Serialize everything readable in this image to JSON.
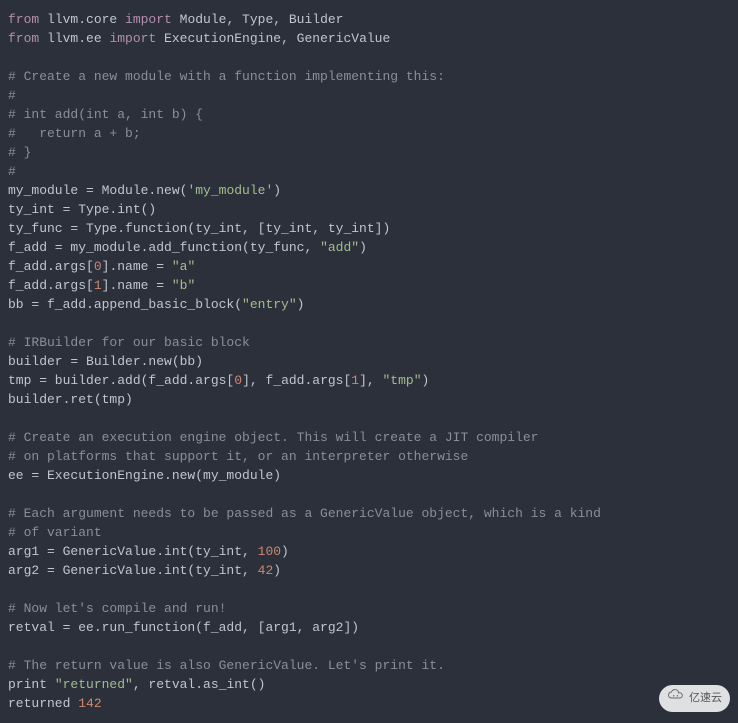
{
  "code": {
    "tokens": [
      [
        {
          "t": "from ",
          "c": "kw"
        },
        {
          "t": "llvm.core ",
          "c": "id"
        },
        {
          "t": "import ",
          "c": "kw"
        },
        {
          "t": "Module, Type, Builder",
          "c": "id"
        }
      ],
      [
        {
          "t": "from ",
          "c": "kw"
        },
        {
          "t": "llvm.ee ",
          "c": "id"
        },
        {
          "t": "import ",
          "c": "kw"
        },
        {
          "t": "ExecutionEngine, GenericValue",
          "c": "id"
        }
      ],
      [],
      [
        {
          "t": "# Create a new module with a function implementing this:",
          "c": "cm2"
        }
      ],
      [
        {
          "t": "#",
          "c": "cm2"
        }
      ],
      [
        {
          "t": "# int add(int a, int b) {",
          "c": "cm2"
        }
      ],
      [
        {
          "t": "#   return a + b;",
          "c": "cm2"
        }
      ],
      [
        {
          "t": "# }",
          "c": "cm2"
        }
      ],
      [
        {
          "t": "#",
          "c": "cm2"
        }
      ],
      [
        {
          "t": "my_module = Module.new(",
          "c": "id"
        },
        {
          "t": "'my_module'",
          "c": "str"
        },
        {
          "t": ")",
          "c": "id"
        }
      ],
      [
        {
          "t": "ty_int = Type.int()",
          "c": "id"
        }
      ],
      [
        {
          "t": "ty_func = Type.function(ty_int, [ty_int, ty_int])",
          "c": "id"
        }
      ],
      [
        {
          "t": "f_add = my_module.add_function(ty_func, ",
          "c": "id"
        },
        {
          "t": "\"add\"",
          "c": "str"
        },
        {
          "t": ")",
          "c": "id"
        }
      ],
      [
        {
          "t": "f_add.args[",
          "c": "id"
        },
        {
          "t": "0",
          "c": "num"
        },
        {
          "t": "].name = ",
          "c": "id"
        },
        {
          "t": "\"a\"",
          "c": "str"
        }
      ],
      [
        {
          "t": "f_add.args[",
          "c": "id"
        },
        {
          "t": "1",
          "c": "num"
        },
        {
          "t": "].name = ",
          "c": "id"
        },
        {
          "t": "\"b\"",
          "c": "str"
        }
      ],
      [
        {
          "t": "bb = f_add.append_basic_block(",
          "c": "id"
        },
        {
          "t": "\"entry\"",
          "c": "str"
        },
        {
          "t": ")",
          "c": "id"
        }
      ],
      [],
      [
        {
          "t": "# IRBuilder for our basic block",
          "c": "cm2"
        }
      ],
      [
        {
          "t": "builder = Builder.new(bb)",
          "c": "id"
        }
      ],
      [
        {
          "t": "tmp = builder.add(f_add.args[",
          "c": "id"
        },
        {
          "t": "0",
          "c": "num"
        },
        {
          "t": "], f_add.args[",
          "c": "id"
        },
        {
          "t": "1",
          "c": "num"
        },
        {
          "t": "], ",
          "c": "id"
        },
        {
          "t": "\"tmp\"",
          "c": "str"
        },
        {
          "t": ")",
          "c": "id"
        }
      ],
      [
        {
          "t": "builder.ret(tmp)",
          "c": "id"
        }
      ],
      [],
      [
        {
          "t": "# Create an execution engine object. This will create a JIT compiler",
          "c": "cm2"
        }
      ],
      [
        {
          "t": "# on platforms that support it, or an interpreter otherwise",
          "c": "cm2"
        }
      ],
      [
        {
          "t": "ee = ExecutionEngine.new(my_module)",
          "c": "id"
        }
      ],
      [],
      [
        {
          "t": "# Each argument needs to be passed as a GenericValue object, which is a kind",
          "c": "cm2"
        }
      ],
      [
        {
          "t": "# of variant",
          "c": "cm2"
        }
      ],
      [
        {
          "t": "arg1 = GenericValue.int(ty_int, ",
          "c": "id"
        },
        {
          "t": "100",
          "c": "num"
        },
        {
          "t": ")",
          "c": "id"
        }
      ],
      [
        {
          "t": "arg2 = GenericValue.int(ty_int, ",
          "c": "id"
        },
        {
          "t": "42",
          "c": "num"
        },
        {
          "t": ")",
          "c": "id"
        }
      ],
      [],
      [
        {
          "t": "# Now let's compile and run!",
          "c": "cm2"
        }
      ],
      [
        {
          "t": "retval = ee.run_function(f_add, [arg1, arg2])",
          "c": "id"
        }
      ],
      [],
      [
        {
          "t": "# The return value is also GenericValue. Let's print it.",
          "c": "cm2"
        }
      ],
      [
        {
          "t": "print ",
          "c": "id"
        },
        {
          "t": "\"returned\"",
          "c": "str"
        },
        {
          "t": ", retval.as_int()",
          "c": "id"
        }
      ],
      [
        {
          "t": "returned ",
          "c": "id"
        },
        {
          "t": "142",
          "c": "num"
        }
      ]
    ]
  },
  "watermark": {
    "text": "亿速云"
  }
}
